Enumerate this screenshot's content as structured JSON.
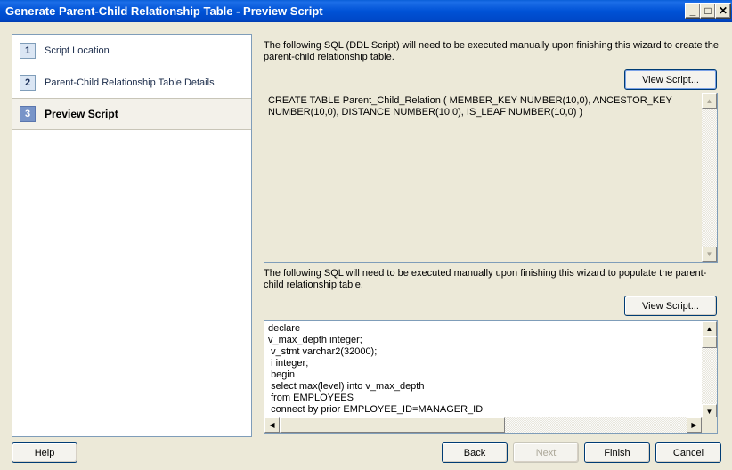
{
  "window": {
    "title": "Generate Parent-Child Relationship Table - Preview Script",
    "minimize_glyph": "_",
    "maximize_glyph": "□",
    "close_glyph": "✕"
  },
  "steps": [
    {
      "number": "1",
      "label": "Script Location"
    },
    {
      "number": "2",
      "label": "Parent-Child Relationship Table Details"
    },
    {
      "number": "3",
      "label": "Preview Script"
    }
  ],
  "ddl": {
    "description": "The following SQL (DDL Script) will need to be executed manually upon finishing this wizard to create the parent-child relationship table.",
    "view_button": "View Script...",
    "script": "CREATE TABLE Parent_Child_Relation ( MEMBER_KEY NUMBER(10,0), ANCESTOR_KEY\nNUMBER(10,0), DISTANCE NUMBER(10,0), IS_LEAF NUMBER(10,0) )"
  },
  "populate": {
    "description": "The following SQL will need to be executed manually upon finishing this wizard to populate the parent-child relationship table.",
    "view_button": "View Script...",
    "script": "declare\nv_max_depth integer;\n v_stmt varchar2(32000);\n i integer;\n begin\n select max(level) into v_max_depth\n from EMPLOYEES\n connect by prior EMPLOYEE_ID=MANAGER_ID"
  },
  "footer": {
    "help": "Help",
    "back": "Back",
    "next": "Next",
    "finish": "Finish",
    "cancel": "Cancel"
  },
  "scroll_glyphs": {
    "up": "▲",
    "down": "▼",
    "left": "◀",
    "right": "▶"
  }
}
